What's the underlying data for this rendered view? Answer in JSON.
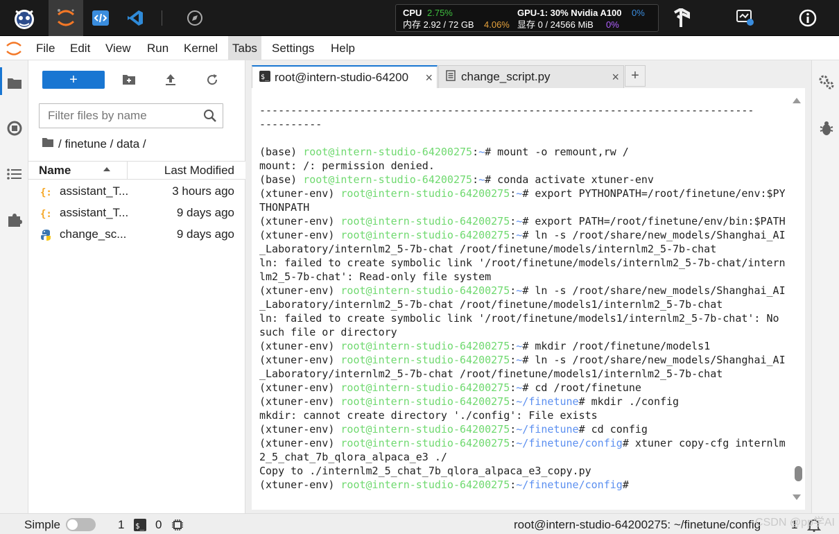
{
  "topbar": {
    "stats": {
      "cpu_label": "CPU",
      "cpu_value": "2.75%",
      "mem_label": "内存 2.92 / 72 GB",
      "mem_percent": "4.06%",
      "gpu_label": "GPU-1: 30% Nvidia A100",
      "gpu_value": "0%",
      "vram_label": "显存 0 / 24566 MiB",
      "vram_value": "0%"
    },
    "icons": [
      "avatar-logo-icon",
      "jupyter-icon",
      "code-editor-icon",
      "vscode-icon",
      "compass-icon",
      "tensorflow-icon",
      "monitor-settings-icon",
      "info-icon"
    ]
  },
  "menu": {
    "items": [
      "File",
      "Edit",
      "View",
      "Run",
      "Kernel",
      "Tabs",
      "Settings",
      "Help"
    ],
    "active": "Tabs"
  },
  "filebrowser": {
    "new_button_label": "+",
    "filter_placeholder": "Filter files by name",
    "breadcrumb": "/ finetune / data /",
    "header_name": "Name",
    "header_modified": "Last Modified",
    "files": [
      {
        "name": "assistant_T...",
        "modified": "3 hours ago",
        "icon": "json-file-icon"
      },
      {
        "name": "assistant_T...",
        "modified": "9 days ago",
        "icon": "json-file-icon"
      },
      {
        "name": "change_sc...",
        "modified": "9 days ago",
        "icon": "python-file-icon"
      }
    ]
  },
  "tabs": [
    {
      "label": "root@intern-studio-64200",
      "icon": "terminal-icon",
      "close": "×"
    },
    {
      "label": "change_script.py",
      "icon": "text-file-icon",
      "close": "×"
    }
  ],
  "add_tab_label": "+",
  "terminal": {
    "lines": [
      [
        {
          "t": "-------------------------------------------------------------------------------"
        }
      ],
      [
        {
          "t": "----------"
        }
      ],
      [
        {
          "t": ""
        }
      ],
      [
        {
          "t": "(base) "
        },
        {
          "t": "root@intern-studio-64200275",
          "c": "g"
        },
        {
          "t": ":"
        },
        {
          "t": "~",
          "c": "b"
        },
        {
          "t": "# mount -o remount,rw /"
        }
      ],
      [
        {
          "t": "mount: /: permission denied."
        }
      ],
      [
        {
          "t": "(base) "
        },
        {
          "t": "root@intern-studio-64200275",
          "c": "g"
        },
        {
          "t": ":"
        },
        {
          "t": "~",
          "c": "b"
        },
        {
          "t": "# conda activate xtuner-env"
        }
      ],
      [
        {
          "t": "(xtuner-env) "
        },
        {
          "t": "root@intern-studio-64200275",
          "c": "g"
        },
        {
          "t": ":"
        },
        {
          "t": "~",
          "c": "b"
        },
        {
          "t": "# export PYTHONPATH=/root/finetune/env:$PY"
        }
      ],
      [
        {
          "t": "THONPATH"
        }
      ],
      [
        {
          "t": "(xtuner-env) "
        },
        {
          "t": "root@intern-studio-64200275",
          "c": "g"
        },
        {
          "t": ":"
        },
        {
          "t": "~",
          "c": "b"
        },
        {
          "t": "# export PATH=/root/finetune/env/bin:$PATH"
        }
      ],
      [
        {
          "t": "(xtuner-env) "
        },
        {
          "t": "root@intern-studio-64200275",
          "c": "g"
        },
        {
          "t": ":"
        },
        {
          "t": "~",
          "c": "b"
        },
        {
          "t": "# ln -s /root/share/new_models/Shanghai_AI"
        }
      ],
      [
        {
          "t": "_Laboratory/internlm2_5-7b-chat /root/finetune/models/internlm2_5-7b-chat"
        }
      ],
      [
        {
          "t": "ln: failed to create symbolic link '/root/finetune/models/internlm2_5-7b-chat/intern"
        }
      ],
      [
        {
          "t": "lm2_5-7b-chat': Read-only file system"
        }
      ],
      [
        {
          "t": "(xtuner-env) "
        },
        {
          "t": "root@intern-studio-64200275",
          "c": "g"
        },
        {
          "t": ":"
        },
        {
          "t": "~",
          "c": "b"
        },
        {
          "t": "# ln -s /root/share/new_models/Shanghai_AI"
        }
      ],
      [
        {
          "t": "_Laboratory/internlm2_5-7b-chat /root/finetune/models1/internlm2_5-7b-chat"
        }
      ],
      [
        {
          "t": "ln: failed to create symbolic link '/root/finetune/models1/internlm2_5-7b-chat': No"
        }
      ],
      [
        {
          "t": "such file or directory"
        }
      ],
      [
        {
          "t": "(xtuner-env) "
        },
        {
          "t": "root@intern-studio-64200275",
          "c": "g"
        },
        {
          "t": ":"
        },
        {
          "t": "~",
          "c": "b"
        },
        {
          "t": "# mkdir /root/finetune/models1"
        }
      ],
      [
        {
          "t": "(xtuner-env) "
        },
        {
          "t": "root@intern-studio-64200275",
          "c": "g"
        },
        {
          "t": ":"
        },
        {
          "t": "~",
          "c": "b"
        },
        {
          "t": "# ln -s /root/share/new_models/Shanghai_AI"
        }
      ],
      [
        {
          "t": "_Laboratory/internlm2_5-7b-chat /root/finetune/models1/internlm2_5-7b-chat"
        }
      ],
      [
        {
          "t": "(xtuner-env) "
        },
        {
          "t": "root@intern-studio-64200275",
          "c": "g"
        },
        {
          "t": ":"
        },
        {
          "t": "~",
          "c": "b"
        },
        {
          "t": "# cd /root/finetune"
        }
      ],
      [
        {
          "t": "(xtuner-env) "
        },
        {
          "t": "root@intern-studio-64200275",
          "c": "g"
        },
        {
          "t": ":"
        },
        {
          "t": "~/finetune",
          "c": "b"
        },
        {
          "t": "# mkdir ./config"
        }
      ],
      [
        {
          "t": "mkdir: cannot create directory './config': File exists"
        }
      ],
      [
        {
          "t": "(xtuner-env) "
        },
        {
          "t": "root@intern-studio-64200275",
          "c": "g"
        },
        {
          "t": ":"
        },
        {
          "t": "~/finetune",
          "c": "b"
        },
        {
          "t": "# cd config"
        }
      ],
      [
        {
          "t": "(xtuner-env) "
        },
        {
          "t": "root@intern-studio-64200275",
          "c": "g"
        },
        {
          "t": ":"
        },
        {
          "t": "~/finetune/config",
          "c": "b"
        },
        {
          "t": "# xtuner copy-cfg internlm"
        }
      ],
      [
        {
          "t": "2_5_chat_7b_qlora_alpaca_e3 ./"
        }
      ],
      [
        {
          "t": "Copy to ./internlm2_5_chat_7b_qlora_alpaca_e3_copy.py"
        }
      ],
      [
        {
          "t": "(xtuner-env) "
        },
        {
          "t": "root@intern-studio-64200275",
          "c": "g"
        },
        {
          "t": ":"
        },
        {
          "t": "~/finetune/config",
          "c": "b"
        },
        {
          "t": "#"
        }
      ]
    ]
  },
  "statusbar": {
    "mode_label": "Simple",
    "kernel_count": "1",
    "terminal_count": "0",
    "path": "root@intern-studio-64200275: ~/finetune/config",
    "line_indicator": "1"
  },
  "watermark": "CSDN @pp学AI"
}
